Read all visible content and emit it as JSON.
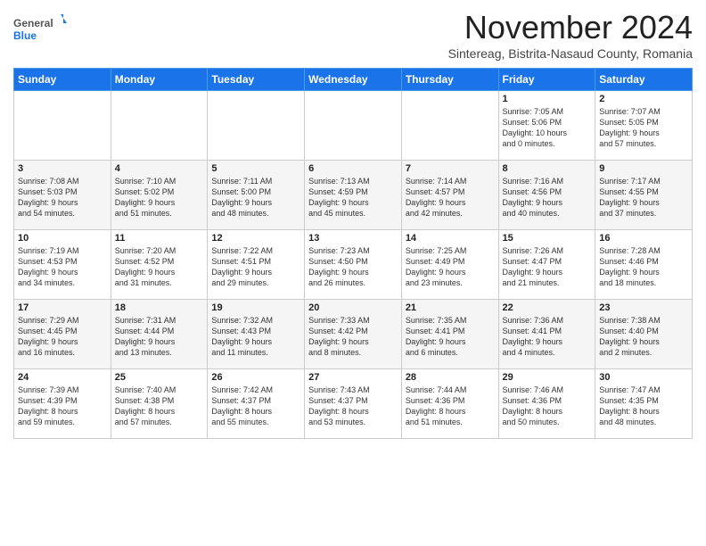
{
  "header": {
    "logo_general": "General",
    "logo_blue": "Blue",
    "month_title": "November 2024",
    "subtitle": "Sintereag, Bistrita-Nasaud County, Romania"
  },
  "calendar": {
    "days_of_week": [
      "Sunday",
      "Monday",
      "Tuesday",
      "Wednesday",
      "Thursday",
      "Friday",
      "Saturday"
    ],
    "weeks": [
      [
        {
          "day": "",
          "info": ""
        },
        {
          "day": "",
          "info": ""
        },
        {
          "day": "",
          "info": ""
        },
        {
          "day": "",
          "info": ""
        },
        {
          "day": "",
          "info": ""
        },
        {
          "day": "1",
          "info": "Sunrise: 7:05 AM\nSunset: 5:06 PM\nDaylight: 10 hours\nand 0 minutes."
        },
        {
          "day": "2",
          "info": "Sunrise: 7:07 AM\nSunset: 5:05 PM\nDaylight: 9 hours\nand 57 minutes."
        }
      ],
      [
        {
          "day": "3",
          "info": "Sunrise: 7:08 AM\nSunset: 5:03 PM\nDaylight: 9 hours\nand 54 minutes."
        },
        {
          "day": "4",
          "info": "Sunrise: 7:10 AM\nSunset: 5:02 PM\nDaylight: 9 hours\nand 51 minutes."
        },
        {
          "day": "5",
          "info": "Sunrise: 7:11 AM\nSunset: 5:00 PM\nDaylight: 9 hours\nand 48 minutes."
        },
        {
          "day": "6",
          "info": "Sunrise: 7:13 AM\nSunset: 4:59 PM\nDaylight: 9 hours\nand 45 minutes."
        },
        {
          "day": "7",
          "info": "Sunrise: 7:14 AM\nSunset: 4:57 PM\nDaylight: 9 hours\nand 42 minutes."
        },
        {
          "day": "8",
          "info": "Sunrise: 7:16 AM\nSunset: 4:56 PM\nDaylight: 9 hours\nand 40 minutes."
        },
        {
          "day": "9",
          "info": "Sunrise: 7:17 AM\nSunset: 4:55 PM\nDaylight: 9 hours\nand 37 minutes."
        }
      ],
      [
        {
          "day": "10",
          "info": "Sunrise: 7:19 AM\nSunset: 4:53 PM\nDaylight: 9 hours\nand 34 minutes."
        },
        {
          "day": "11",
          "info": "Sunrise: 7:20 AM\nSunset: 4:52 PM\nDaylight: 9 hours\nand 31 minutes."
        },
        {
          "day": "12",
          "info": "Sunrise: 7:22 AM\nSunset: 4:51 PM\nDaylight: 9 hours\nand 29 minutes."
        },
        {
          "day": "13",
          "info": "Sunrise: 7:23 AM\nSunset: 4:50 PM\nDaylight: 9 hours\nand 26 minutes."
        },
        {
          "day": "14",
          "info": "Sunrise: 7:25 AM\nSunset: 4:49 PM\nDaylight: 9 hours\nand 23 minutes."
        },
        {
          "day": "15",
          "info": "Sunrise: 7:26 AM\nSunset: 4:47 PM\nDaylight: 9 hours\nand 21 minutes."
        },
        {
          "day": "16",
          "info": "Sunrise: 7:28 AM\nSunset: 4:46 PM\nDaylight: 9 hours\nand 18 minutes."
        }
      ],
      [
        {
          "day": "17",
          "info": "Sunrise: 7:29 AM\nSunset: 4:45 PM\nDaylight: 9 hours\nand 16 minutes."
        },
        {
          "day": "18",
          "info": "Sunrise: 7:31 AM\nSunset: 4:44 PM\nDaylight: 9 hours\nand 13 minutes."
        },
        {
          "day": "19",
          "info": "Sunrise: 7:32 AM\nSunset: 4:43 PM\nDaylight: 9 hours\nand 11 minutes."
        },
        {
          "day": "20",
          "info": "Sunrise: 7:33 AM\nSunset: 4:42 PM\nDaylight: 9 hours\nand 8 minutes."
        },
        {
          "day": "21",
          "info": "Sunrise: 7:35 AM\nSunset: 4:41 PM\nDaylight: 9 hours\nand 6 minutes."
        },
        {
          "day": "22",
          "info": "Sunrise: 7:36 AM\nSunset: 4:41 PM\nDaylight: 9 hours\nand 4 minutes."
        },
        {
          "day": "23",
          "info": "Sunrise: 7:38 AM\nSunset: 4:40 PM\nDaylight: 9 hours\nand 2 minutes."
        }
      ],
      [
        {
          "day": "24",
          "info": "Sunrise: 7:39 AM\nSunset: 4:39 PM\nDaylight: 8 hours\nand 59 minutes."
        },
        {
          "day": "25",
          "info": "Sunrise: 7:40 AM\nSunset: 4:38 PM\nDaylight: 8 hours\nand 57 minutes."
        },
        {
          "day": "26",
          "info": "Sunrise: 7:42 AM\nSunset: 4:37 PM\nDaylight: 8 hours\nand 55 minutes."
        },
        {
          "day": "27",
          "info": "Sunrise: 7:43 AM\nSunset: 4:37 PM\nDaylight: 8 hours\nand 53 minutes."
        },
        {
          "day": "28",
          "info": "Sunrise: 7:44 AM\nSunset: 4:36 PM\nDaylight: 8 hours\nand 51 minutes."
        },
        {
          "day": "29",
          "info": "Sunrise: 7:46 AM\nSunset: 4:36 PM\nDaylight: 8 hours\nand 50 minutes."
        },
        {
          "day": "30",
          "info": "Sunrise: 7:47 AM\nSunset: 4:35 PM\nDaylight: 8 hours\nand 48 minutes."
        }
      ]
    ]
  }
}
